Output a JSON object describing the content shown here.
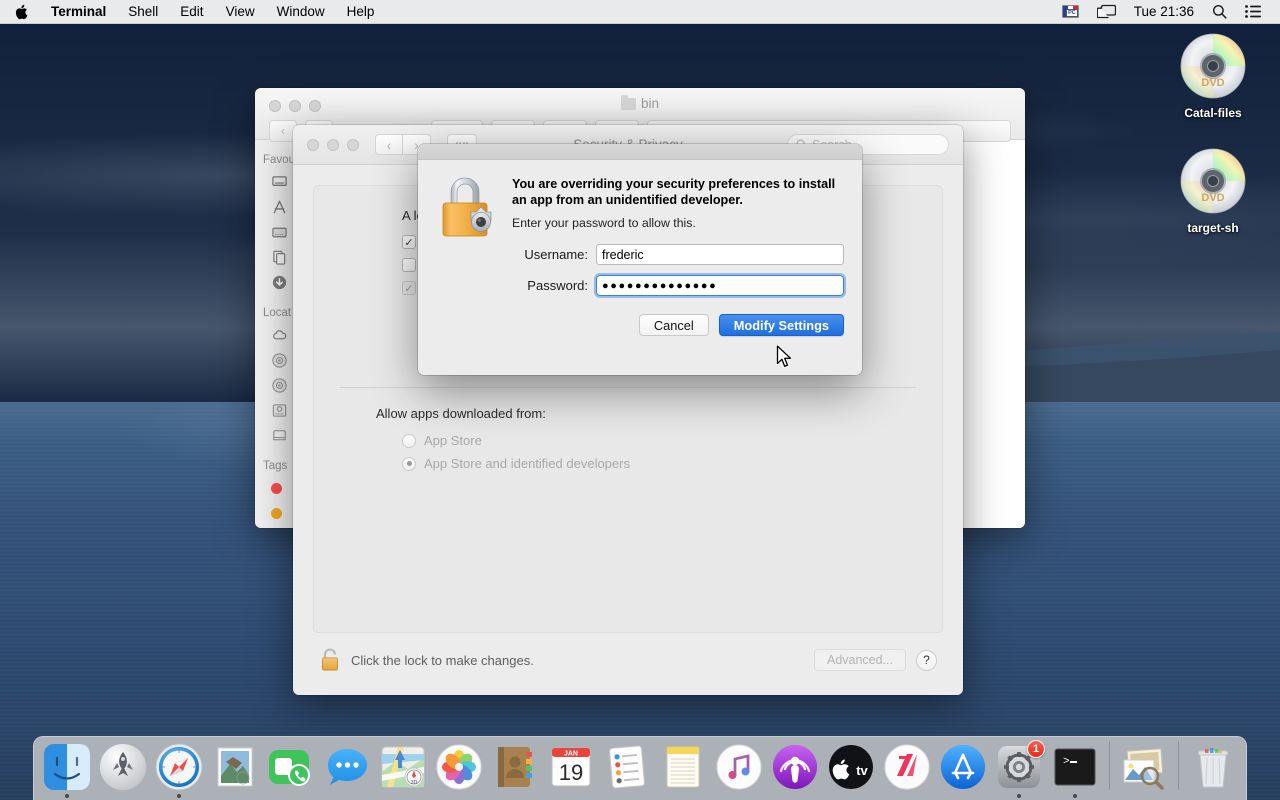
{
  "menubar": {
    "apple_icon": "apple-logo-icon",
    "items": [
      {
        "label": "Terminal",
        "bold": true
      },
      {
        "label": "Shell",
        "bold": false
      },
      {
        "label": "Edit",
        "bold": false
      },
      {
        "label": "View",
        "bold": false
      },
      {
        "label": "Window",
        "bold": false
      },
      {
        "label": "Help",
        "bold": false
      }
    ],
    "status": {
      "keyboard_flag": "FR",
      "keyboard_badge": "PC",
      "screen_mirroring_icon": "display-icon",
      "clock": "Tue 21:36",
      "search_icon": "search-icon",
      "control_center_icon": "control-center-icon"
    }
  },
  "desktop": {
    "icons": [
      {
        "label": "Catal-files",
        "type": "dvd-disc-icon"
      },
      {
        "label": "target-sh",
        "type": "dvd-disc-icon"
      }
    ]
  },
  "finder_window": {
    "title": "bin",
    "title_icon": "folder-icon",
    "sidebar": {
      "favourites_header": "Favou",
      "locations_header": "Locat",
      "tags_header": "Tags",
      "favourites": [
        "airdrop-icon",
        "applications-icon",
        "desktop-icon",
        "documents-icon",
        "downloads-icon"
      ],
      "locations": [
        "icloud-icon",
        "disc-icon",
        "disc-icon",
        "harddisk-icon",
        "drive-icon"
      ],
      "tags": [
        "#fa4d4d",
        "#f5a623"
      ]
    }
  },
  "security_window": {
    "title": "Security & Privacy",
    "back_icon": "chevron-left-icon",
    "forward_icon": "chevron-right-icon",
    "grid_icon": "grid-icon",
    "search_placeholder": "Search",
    "search_icon": "search-icon",
    "intro_text": "A login",
    "checkboxes": [
      {
        "checked": true,
        "disabled": false
      },
      {
        "checked": false,
        "disabled": false
      },
      {
        "checked": true,
        "disabled": true
      }
    ],
    "allow_label": "Allow apps downloaded from:",
    "radios": [
      {
        "label": "App Store",
        "selected": false
      },
      {
        "label": "App Store and identified developers",
        "selected": true
      }
    ],
    "footer": {
      "lock_icon": "unlocked-padlock-icon",
      "lock_message": "Click the lock to make changes.",
      "advanced_button": "Advanced...",
      "help_button": "?"
    }
  },
  "auth_dialog": {
    "icon": "padlock-with-gear-icon",
    "heading": "You are overriding your security preferences to install an app from an unidentified developer.",
    "subtext": "Enter your password to allow this.",
    "username_label": "Username:",
    "username_value": "frederic",
    "password_label": "Password:",
    "password_value": "●●●●●●●●●●●●●●",
    "cancel_button": "Cancel",
    "confirm_button": "Modify Settings",
    "accent_color": "#2171e0"
  },
  "dock": {
    "items": [
      {
        "name": "finder",
        "running": true
      },
      {
        "name": "launchpad",
        "running": false
      },
      {
        "name": "safari",
        "running": true
      },
      {
        "name": "mail",
        "running": false
      },
      {
        "name": "facetime",
        "running": false
      },
      {
        "name": "messages",
        "running": false
      },
      {
        "name": "maps",
        "running": false
      },
      {
        "name": "photos",
        "running": false
      },
      {
        "name": "contacts",
        "running": false
      },
      {
        "name": "calendar",
        "running": false,
        "month": "JAN",
        "day": "19"
      },
      {
        "name": "reminders",
        "running": false
      },
      {
        "name": "notes",
        "running": false
      },
      {
        "name": "itunes",
        "running": false
      },
      {
        "name": "podcasts",
        "running": false
      },
      {
        "name": "appletv",
        "running": false
      },
      {
        "name": "news",
        "running": false
      },
      {
        "name": "appstore",
        "running": false
      },
      {
        "name": "system-preferences",
        "running": true,
        "badge": "1"
      },
      {
        "name": "terminal",
        "running": true
      },
      {
        "name": "preview",
        "running": false
      },
      {
        "name": "trash",
        "running": false
      }
    ]
  }
}
